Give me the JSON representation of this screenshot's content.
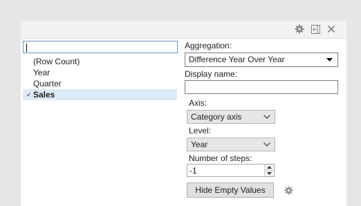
{
  "titlebar": {
    "icons": [
      "gear-icon",
      "dock-icon",
      "close-icon"
    ]
  },
  "search": {
    "value": ""
  },
  "columns": [
    {
      "label": "(Row Count)",
      "selected": false
    },
    {
      "label": "Year",
      "selected": false
    },
    {
      "label": "Quarter",
      "selected": false
    },
    {
      "label": "Sales",
      "selected": true
    }
  ],
  "aggregation": {
    "label": "Aggregation:",
    "value": "Difference Year Over Year"
  },
  "display_name": {
    "label": "Display name:",
    "value": ""
  },
  "axis": {
    "label": "Axis:",
    "value": "Category axis"
  },
  "level": {
    "label": "Level:",
    "value": "Year"
  },
  "steps": {
    "label": "Number of steps:",
    "value": "-1"
  },
  "hide_empty_button": {
    "label": "Hide Empty Values"
  },
  "colors": {
    "background": "#e6e6e6",
    "panel": "#ffffff",
    "selected_row": "#dce9f6"
  }
}
